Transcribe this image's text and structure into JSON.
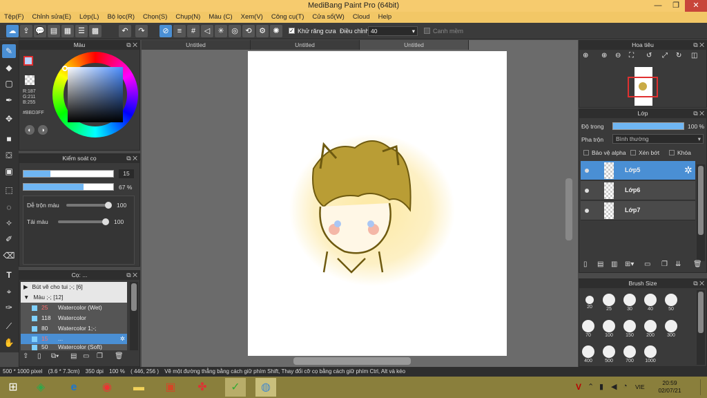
{
  "window": {
    "title": "MediBang Paint Pro (64bit)",
    "minimize": "—",
    "restore": "❐",
    "close": "✕"
  },
  "menu": [
    "Tệp(F)",
    "Chỉnh sửa(E)",
    "Lớp(L)",
    "Bộ lọc(R)",
    "Chọn(S)",
    "Chụp(N)",
    "Màu (C)",
    "Xem(V)",
    "Công cụ(T)",
    "Cửa sổ(W)",
    "Cloud",
    "Help"
  ],
  "toolbar": {
    "antialias_label": "Khử răng cưa",
    "correction_label": "Điều chỉnh",
    "correction_value": "40",
    "canvas_label": "Canh mềm"
  },
  "color_panel": {
    "title": "Màu",
    "r": "R:187",
    "g": "G:211",
    "b": "B:255",
    "hex": "#BBD3FF"
  },
  "brush_control": {
    "title": "Kiểm soát cọ",
    "size": "15",
    "size_fill": 0.3,
    "opacity": "67 %",
    "opacity_fill": 0.67,
    "blend_label": "Dễ trộn màu",
    "blend_value": "100",
    "amount_label": "Tải màu",
    "amount_value": "100"
  },
  "brush_panel": {
    "title": "Cọ: ...",
    "groups": [
      {
        "label": "Bút vẽ cho tui ;-; [6]",
        "arrow": "▶"
      },
      {
        "label": "Màu ;-; [12]",
        "arrow": "▼"
      }
    ],
    "items": [
      {
        "size": "25",
        "name": "Watercolor (Wet)",
        "selected": false
      },
      {
        "size": "118",
        "name": "Watercolor",
        "selected": false
      },
      {
        "size": "80",
        "name": "Watercolor 1;-;",
        "selected": false
      },
      {
        "size": "15",
        "name": "...",
        "selected": true
      },
      {
        "size": "50",
        "name": "Watercolor (Soft)",
        "selected": false
      }
    ]
  },
  "tabs": [
    "Untitled",
    "Untitled",
    "Untitled"
  ],
  "navigator": {
    "title": "Hoa tiêu"
  },
  "layer_panel": {
    "title": "Lớp",
    "opacity_label": "Độ trong",
    "opacity_value": "100 %",
    "blend_label": "Pha trộn",
    "blend_value": "Bình thường",
    "protect_label": "Bảo vệ alpha",
    "clip_label": "Xén bớt",
    "lock_label": "Khóa",
    "layers": [
      "Lớp5",
      "Lớp6",
      "Lớp7"
    ]
  },
  "brush_size": {
    "title": "Brush Size",
    "sizes": [
      "20",
      "25",
      "30",
      "40",
      "50",
      "70",
      "100",
      "150",
      "200",
      "300",
      "400",
      "500",
      "700",
      "1000"
    ]
  },
  "status": {
    "dims": "500 * 1000 pixel",
    "cm": "(3.6 * 7.3cm)",
    "dpi": "350 dpi",
    "zoom": "100 %",
    "coord": "( 446, 256 )",
    "hint": "Vẽ một đường thẳng bằng cách giữ phím Shift, Thay đổi cỡ cọ bằng cách giữ phím Ctrl, Alt và kéo"
  },
  "taskbar": {
    "lang": "VIE",
    "time": "20:59",
    "date": "02/07/21"
  },
  "colors": {
    "accent": "#4a8fd4",
    "title_bg": "#f6cb6e",
    "taskbar": "#8a7f3c"
  }
}
